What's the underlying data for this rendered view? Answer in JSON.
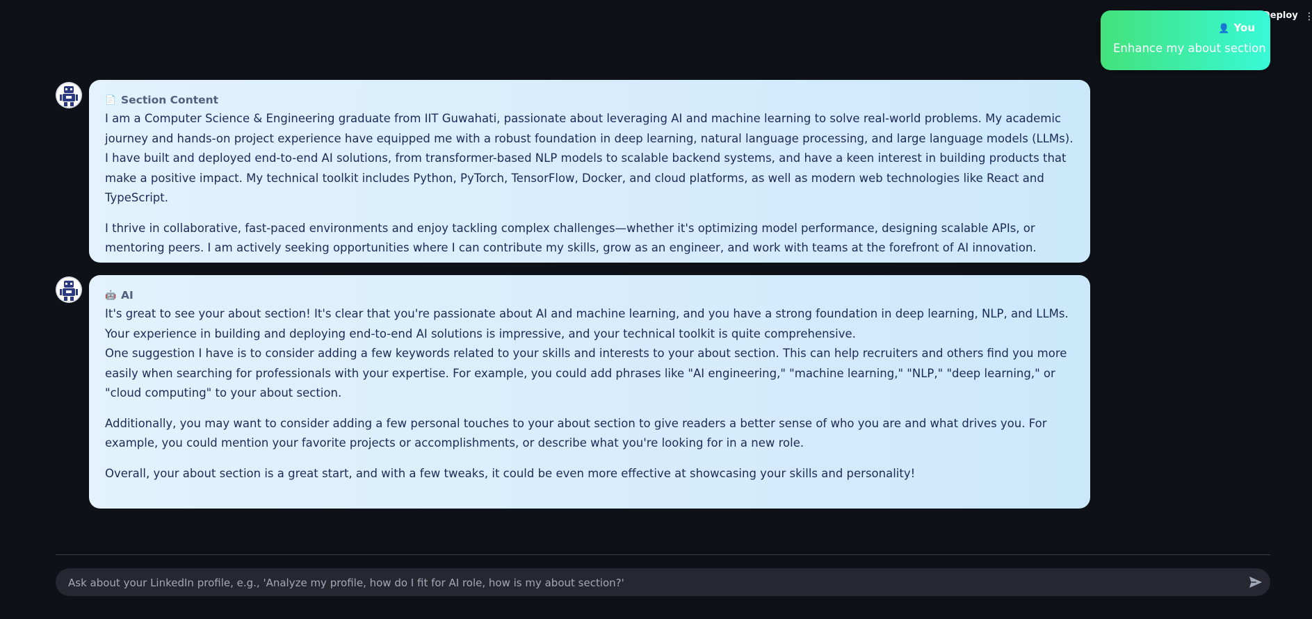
{
  "header": {
    "deploy_label": "Deploy",
    "more_icon": "more-vertical-icon"
  },
  "user_message": {
    "author": "You",
    "author_icon": "person-icon",
    "text": "Enhance my about section"
  },
  "messages": [
    {
      "avatar_icon": "robot-icon",
      "header_icon": "document-icon",
      "title": "Section Content",
      "paragraphs": [
        "I am a Computer Science & Engineering graduate from IIT Guwahati, passionate about leveraging AI and machine learning to solve real-world problems. My academic journey and hands-on project experience have equipped me with a robust foundation in deep learning, natural language processing, and large language models (LLMs).",
        "I have built and deployed end-to-end AI solutions, from transformer-based NLP models to scalable backend systems, and have a keen interest in building products that make a positive impact. My technical toolkit includes Python, PyTorch, TensorFlow, Docker, and cloud platforms, as well as modern web technologies like React and TypeScript.",
        "I thrive in collaborative, fast-paced environments and enjoy tackling complex challenges—whether it's optimizing model performance, designing scalable APIs, or mentoring peers. I am actively seeking opportunities where I can contribute my skills, grow as an engineer, and work with teams at the forefront of AI innovation."
      ]
    },
    {
      "avatar_icon": "robot-icon",
      "header_icon": "robot-icon",
      "title": "AI",
      "paragraphs": [
        "It's great to see your about section! It's clear that you're passionate about AI and machine learning, and you have a strong foundation in deep learning, NLP, and LLMs. Your experience in building and deploying end-to-end AI solutions is impressive, and your technical toolkit is quite comprehensive.",
        "One suggestion I have is to consider adding a few keywords related to your skills and interests to your about section. This can help recruiters and others find you more easily when searching for professionals with your expertise. For example, you could add phrases like \"AI engineering,\" \"machine learning,\" \"NLP,\" \"deep learning,\" or \"cloud computing\" to your about section.",
        "Additionally, you may want to consider adding a few personal touches to your about section to give readers a better sense of who you are and what drives you. For example, you could mention your favorite projects or accomplishments, or describe what you're looking for in a new role.",
        "Overall, your about section is a great start, and with a few tweaks, it could be even more effective at showcasing your skills and personality!"
      ]
    }
  ],
  "chat_input": {
    "placeholder": "Ask about your LinkedIn profile, e.g., 'Analyze my profile, how do I fit for AI role, how is my about section?'",
    "value": "",
    "send_icon": "send-icon"
  }
}
